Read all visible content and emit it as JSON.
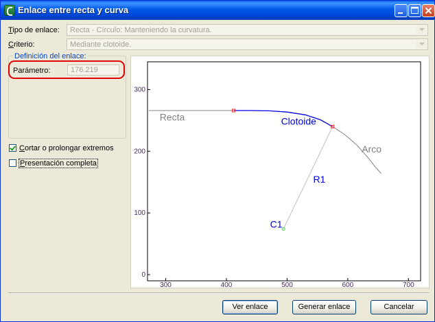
{
  "window": {
    "title": "Enlace entre recta y curva",
    "buttons": [
      "minimize-icon",
      "maximize-icon",
      "close-icon"
    ]
  },
  "form": {
    "tipo_label_first": "T",
    "tipo_label_rest": "ipo de enlace:",
    "tipo_value": "Recta - Círculo: Manteniendo la curvatura.",
    "criterio_label_first": "C",
    "criterio_label_rest": "riterio:",
    "criterio_value": "Mediante clotoide.",
    "group_title": "Definición del enlace:",
    "parametro_label": "Parámetro:",
    "parametro_value": "176.219"
  },
  "options": {
    "cortar_first": "C",
    "cortar_rest": "ortar o prolongar extremos",
    "cortar_checked": true,
    "presentacion_first": "P",
    "presentacion_rest": "resentación completa",
    "presentacion_checked": false
  },
  "buttons": {
    "ver": "Ver enlace",
    "generar": "Generar enlace",
    "cancelar": "Cancelar"
  },
  "colors": {
    "recta": "#808080",
    "clotoide": "#0000e0",
    "arco": "#808080",
    "radius": "#c0c0c0",
    "axis_ticks": "#4b2a63",
    "point_marker": "#ff3030",
    "center_marker": "#40d040"
  },
  "chart_data": {
    "type": "line",
    "xlim": [
      270,
      720
    ],
    "ylim": [
      -10,
      345
    ],
    "x_ticks": [
      300,
      400,
      500,
      600,
      700
    ],
    "y_ticks": [
      0,
      100,
      200,
      300
    ],
    "series": [
      {
        "name": "Recta",
        "points": [
          [
            272,
            266
          ],
          [
            412,
            266
          ]
        ]
      },
      {
        "name": "Clotoide",
        "points": [
          [
            412,
            266
          ],
          [
            440,
            266
          ],
          [
            470,
            265.5
          ],
          [
            500,
            263.5
          ],
          [
            530,
            259
          ],
          [
            555,
            251
          ],
          [
            575,
            240
          ]
        ]
      },
      {
        "name": "Arco",
        "points": [
          [
            575,
            240
          ],
          [
            595,
            227
          ],
          [
            615,
            210
          ],
          [
            633,
            190
          ],
          [
            645,
            175
          ],
          [
            655,
            164
          ]
        ]
      },
      {
        "name": "R1",
        "points": [
          [
            494,
            74
          ],
          [
            575,
            240
          ]
        ]
      }
    ],
    "points": [
      {
        "name": "C1",
        "x": 494,
        "y": 74
      }
    ],
    "junctions": [
      [
        412,
        266
      ],
      [
        575,
        240
      ]
    ],
    "annotations": [
      {
        "text": "Recta",
        "x": 290,
        "y": 250
      },
      {
        "text": "Clotoide",
        "x": 490,
        "y": 243
      },
      {
        "text": "Arco",
        "x": 623,
        "y": 198
      },
      {
        "text": "R1",
        "x": 543,
        "y": 149
      },
      {
        "text": "C1",
        "x": 472,
        "y": 76
      }
    ]
  }
}
